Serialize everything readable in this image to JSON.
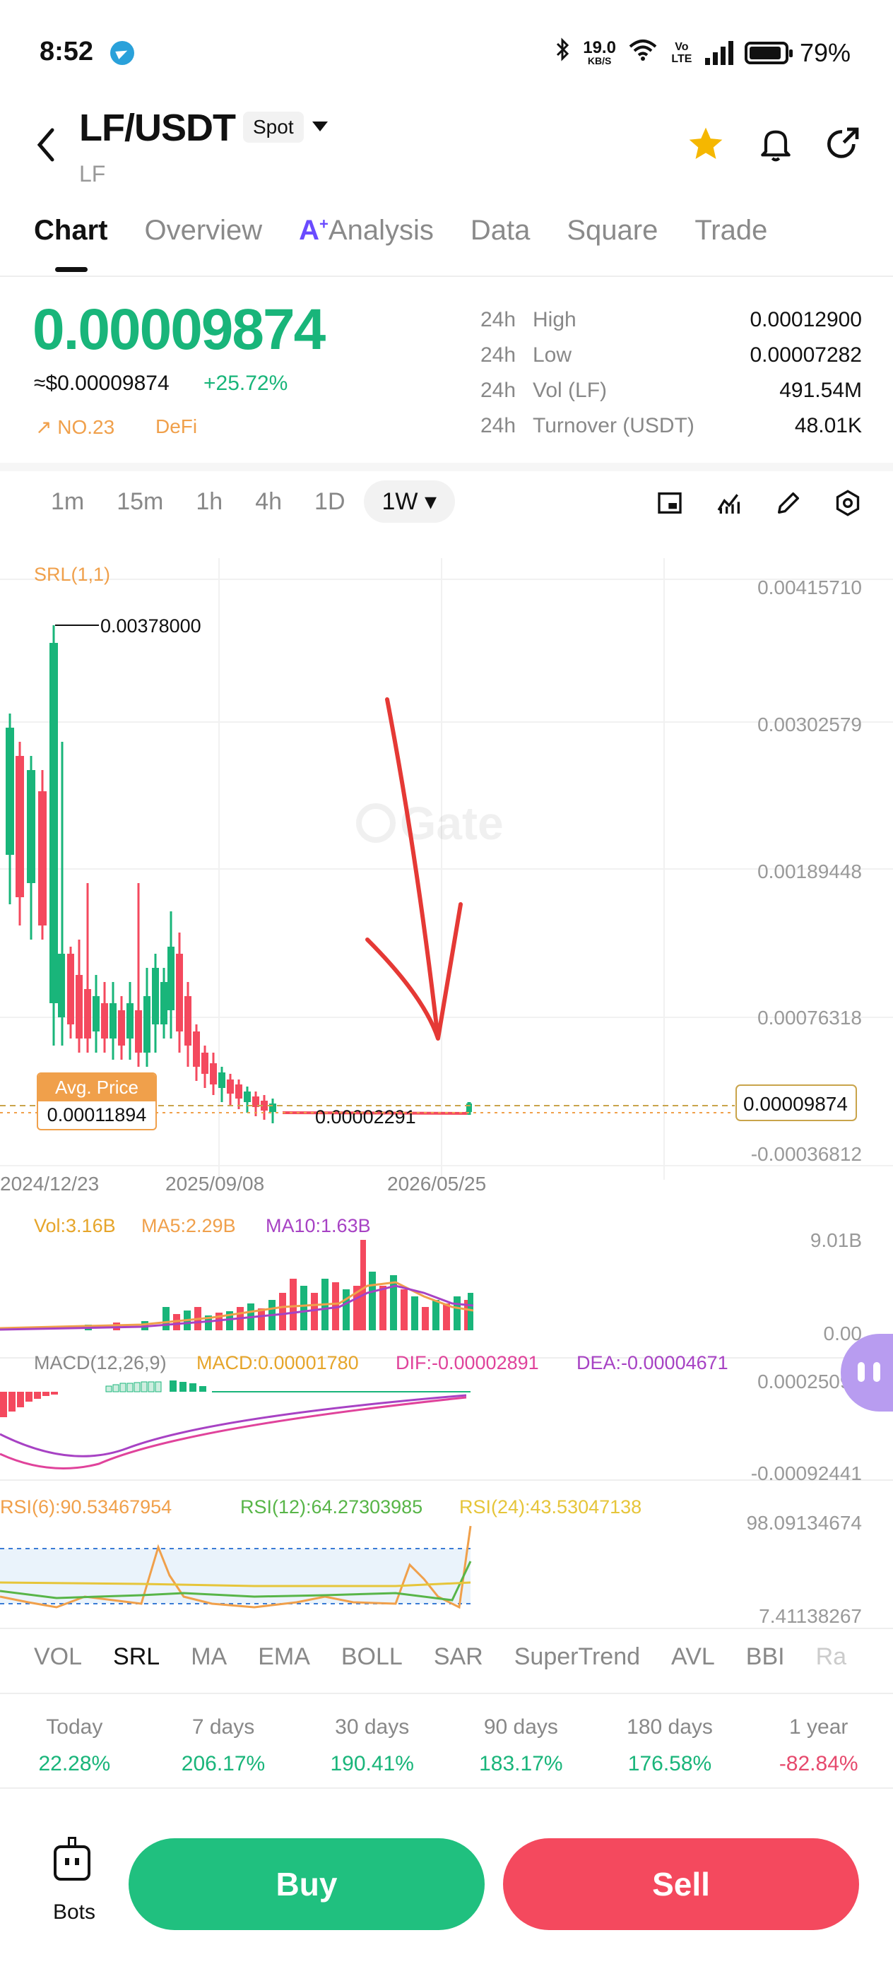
{
  "status_bar": {
    "time": "8:52",
    "net_speed_value": "19.0",
    "net_speed_unit": "KB/S",
    "volte": "Vo LTE",
    "battery": "79%"
  },
  "header": {
    "pair": "LF/USDT",
    "market_type": "Spot",
    "subtitle": "LF"
  },
  "tabs": [
    "Chart",
    "Overview",
    "Analysis",
    "Data",
    "Square",
    "Trade"
  ],
  "ticker": {
    "last_price": "0.00009874",
    "usd_price": "≈$0.00009874",
    "change": "+25.72%",
    "rank": "NO.23",
    "category": "DeFi",
    "stats": [
      {
        "period": "24h",
        "label": "High",
        "value": "0.00012900"
      },
      {
        "period": "24h",
        "label": "Low",
        "value": "0.00007282"
      },
      {
        "period": "24h",
        "label": "Vol (LF)",
        "value": "491.54M"
      },
      {
        "period": "24h",
        "label": "Turnover (USDT)",
        "value": "48.01K"
      }
    ]
  },
  "intervals": [
    "1m",
    "15m",
    "1h",
    "4h",
    "1D",
    "1W"
  ],
  "selected_interval": "1W",
  "main_chart": {
    "indicator_label": "SRL(1,1)",
    "y_ticks": [
      "0.00415710",
      "0.00302579",
      "0.00189448",
      "0.00076318",
      "-0.00036812"
    ],
    "x_ticks": [
      "2024/12/23",
      "2025/09/08",
      "2026/05/25"
    ],
    "high_marker": "0.00378000",
    "low_marker": "0.00002291",
    "current_price_tag": "0.00009874",
    "avg_price_label": "Avg. Price",
    "avg_price_value": "0.00011894",
    "watermark": "Gate"
  },
  "volume_panel": {
    "vol": "Vol:3.16B",
    "ma5": "MA5:2.29B",
    "ma10": "MA10:1.63B",
    "y_top": "9.01B",
    "y_bottom": "0.00"
  },
  "macd_panel": {
    "label": "MACD(12,26,9)",
    "macd": "MACD:0.00001780",
    "dif": "DIF:-0.00002891",
    "dea": "DEA:-0.00004671",
    "y_top": "0.00025099",
    "y_bottom": "-0.00092441"
  },
  "rsi_panel": {
    "rsi6": "RSI(6):90.53467954",
    "rsi12": "RSI(12):64.27303985",
    "rsi24": "RSI(24):43.53047138",
    "y_top": "98.09134674",
    "y_bottom": "7.41138267"
  },
  "indicator_tabs": [
    "VOL",
    "SRL",
    "MA",
    "EMA",
    "BOLL",
    "SAR",
    "SuperTrend",
    "AVL",
    "BBI",
    "Ra"
  ],
  "performance": [
    {
      "label": "Today",
      "value": "22.28%"
    },
    {
      "label": "7 days",
      "value": "206.17%"
    },
    {
      "label": "30 days",
      "value": "190.41%"
    },
    {
      "label": "90 days",
      "value": "183.17%"
    },
    {
      "label": "180 days",
      "value": "176.58%"
    },
    {
      "label": "1 year",
      "value": "-82.84%"
    }
  ],
  "bottom_bar": {
    "bots": "Bots",
    "buy": "Buy",
    "sell": "Sell"
  },
  "colors": {
    "up": "#19b57a",
    "down": "#f4495e",
    "accent": "#f0a04b",
    "annotation": "#e53935"
  }
}
